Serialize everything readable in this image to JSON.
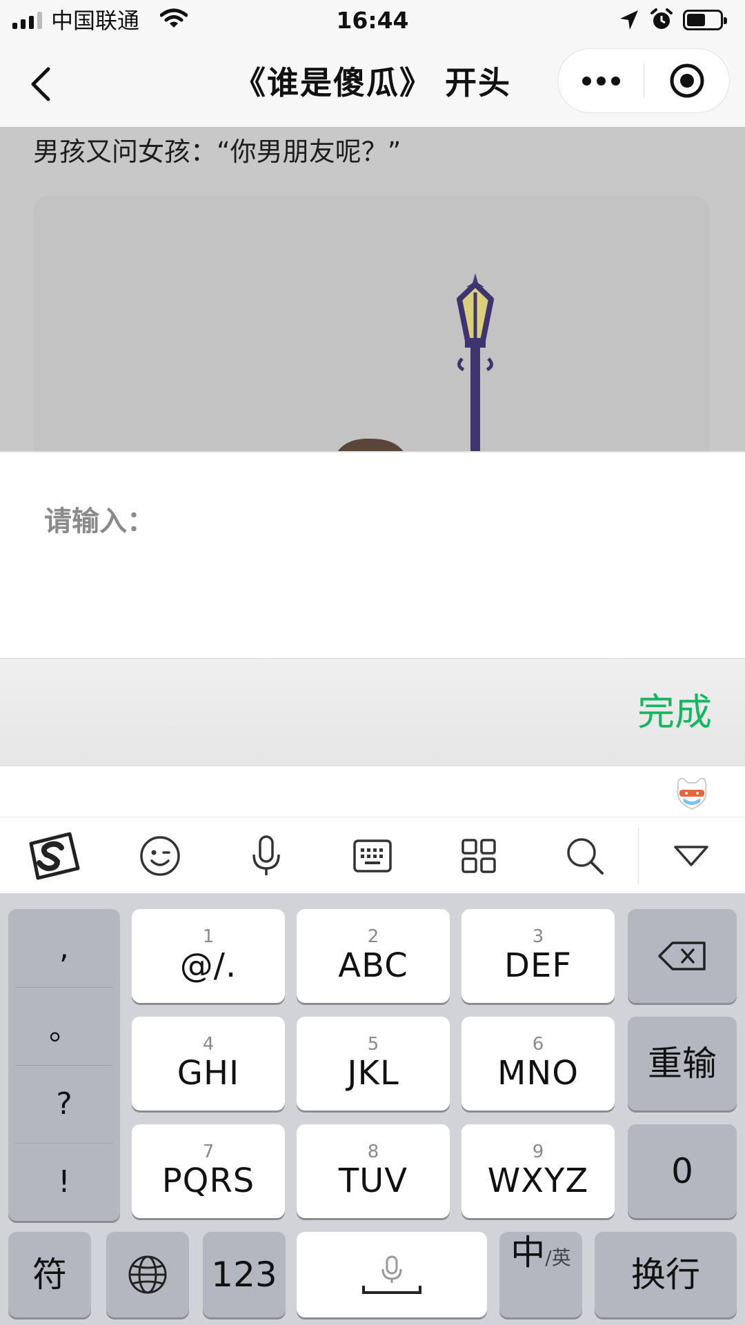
{
  "status_bar": {
    "carrier": "中国联通",
    "time": "16:44"
  },
  "nav": {
    "title": "《谁是傻瓜》 开头"
  },
  "content": {
    "story_line": "男孩又问女孩：“你男朋友呢？”"
  },
  "input": {
    "placeholder": "请输入：",
    "value": ""
  },
  "done_bar": {
    "done_label": "完成"
  },
  "toolbar": {
    "icons": [
      "sogou-logo-icon",
      "emoji-icon",
      "microphone-icon",
      "keyboard-icon",
      "grid-icon",
      "search-icon",
      "collapse-keyboard-icon"
    ]
  },
  "keyboard": {
    "punctuation": [
      ",",
      "。",
      "?",
      "!"
    ],
    "keys": [
      {
        "num": "1",
        "letters": "@/."
      },
      {
        "num": "2",
        "letters": "ABC"
      },
      {
        "num": "3",
        "letters": "DEF"
      },
      {
        "num": "4",
        "letters": "GHI"
      },
      {
        "num": "5",
        "letters": "JKL"
      },
      {
        "num": "6",
        "letters": "MNO"
      },
      {
        "num": "7",
        "letters": "PQRS"
      },
      {
        "num": "8",
        "letters": "TUV"
      },
      {
        "num": "9",
        "letters": "WXYZ"
      }
    ],
    "reenter_label": "重输",
    "zero_label": "0",
    "symbol_label": "符",
    "numbers_label": "123",
    "lang_main": "中",
    "lang_sub": "/英",
    "newline_label": "换行"
  },
  "colors": {
    "accent_green": "#16b562",
    "keyboard_bg": "#d1d3d9",
    "content_overlay": "#c8c8c8"
  }
}
